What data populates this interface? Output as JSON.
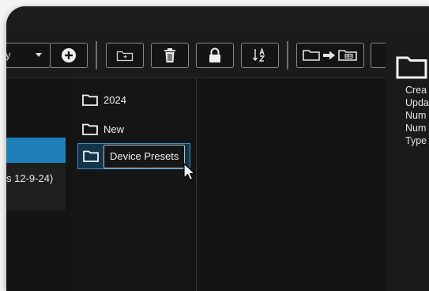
{
  "toolbar": {
    "view_dropdown": {
      "selected": "y"
    },
    "buttons": [
      {
        "name": "add-button",
        "icon": "plus-circle-icon"
      },
      {
        "name": "new-folder-button",
        "icon": "folder-plus-icon"
      },
      {
        "name": "delete-button",
        "icon": "trash-icon"
      },
      {
        "name": "lock-button",
        "icon": "lock-icon"
      },
      {
        "name": "sort-button",
        "icon": "sort-az-icon"
      },
      {
        "name": "move-to-button",
        "icon": "folder-move-icon"
      }
    ]
  },
  "left_column": {
    "partial_item_text": "s 12-9-24)"
  },
  "folders": [
    {
      "label": "2024",
      "state": "normal"
    },
    {
      "label": "New",
      "state": "normal"
    },
    {
      "label": "Device Presets",
      "state": "renaming"
    }
  ],
  "details": {
    "labels": [
      "Crea",
      "Upda",
      "Num",
      "Num",
      "Type"
    ]
  },
  "colors": {
    "accent": "#1e7fb8",
    "selection_border": "#3d8fc3"
  }
}
